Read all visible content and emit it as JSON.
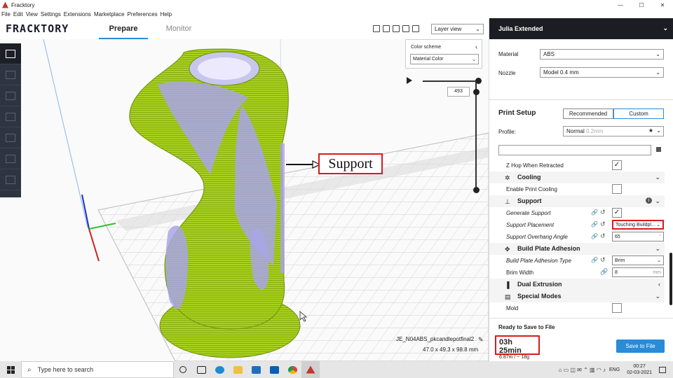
{
  "window": {
    "title": "Fracktory",
    "controls": [
      "—",
      "☐",
      "✕"
    ]
  },
  "menu": [
    "File",
    "Edit",
    "View",
    "Settings",
    "Extensions",
    "Marketplace",
    "Preferences",
    "Help"
  ],
  "header": {
    "logo": "FRACKTORY",
    "tabs": [
      "Prepare",
      "Monitor"
    ],
    "view_mode": "Layer view"
  },
  "color_scheme": {
    "label": "Color scheme",
    "value": "Material Color"
  },
  "layer_slider": {
    "value": "493"
  },
  "annotation": {
    "text": "Support"
  },
  "object": {
    "name": "JE_N04ABS_pkcandlepotfinal2",
    "dims": "47.0 x 49.3 x 98.8 mm"
  },
  "printer": {
    "name": "Julia Extended"
  },
  "material": {
    "label": "Material",
    "value": "ABS"
  },
  "nozzle": {
    "label": "Nozzle",
    "value": "Model 0.4 mm"
  },
  "print_setup": {
    "title": "Print Setup",
    "recommended": "Recommended",
    "custom": "Custom",
    "profile_label": "Profile:",
    "profile_value": "Normal",
    "profile_sub": "0.2mm"
  },
  "settings": {
    "z_hop": "Z Hop When Retracted",
    "cooling": "Cooling",
    "enable_cooling": "Enable Print Cooling",
    "support": "Support",
    "generate_support": "Generate Support",
    "support_placement": "Support Placement",
    "support_placement_value": "Touching Buildpl...",
    "overhang_angle": "Support Overhang Angle",
    "overhang_value": "65",
    "overhang_unit": "°",
    "adhesion": "Build Plate Adhesion",
    "adhesion_type": "Build Plate Adhesion Type",
    "adhesion_type_value": "Brim",
    "brim_width": "Brim Width",
    "brim_width_value": "8",
    "brim_unit": "mm",
    "dual_extrusion": "Dual Extrusion",
    "special_modes": "Special Modes",
    "mold": "Mold"
  },
  "footer": {
    "ready": "Ready to Save to File",
    "time": "03h 25min",
    "material_use": "6.87m / ~ 18g",
    "save": "Save to File"
  },
  "taskbar": {
    "search_placeholder": "Type here to search",
    "lang": "ENG",
    "time": "00:27",
    "date": "02-03-2021"
  },
  "colors": {
    "accent": "#2a8bd6",
    "model": "#a8d21c",
    "support": "#a9a4e8",
    "annotation": "#d81b1b"
  }
}
